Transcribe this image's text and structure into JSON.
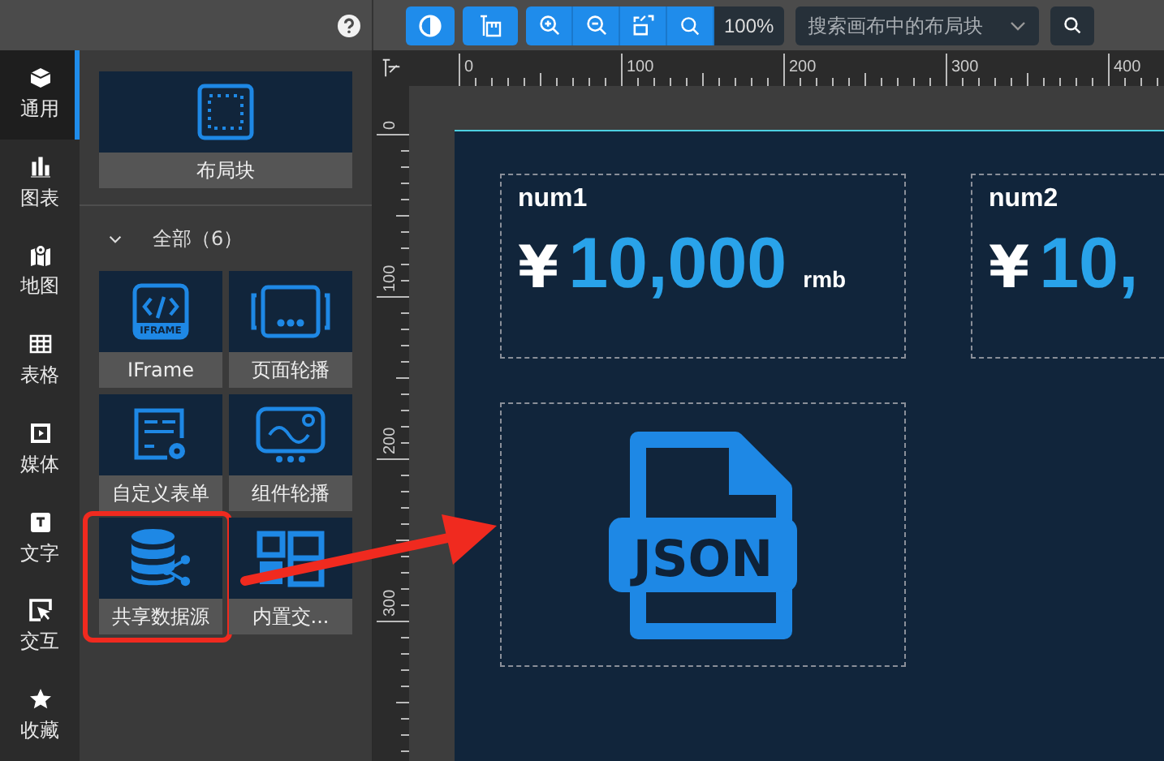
{
  "nav_items": [
    {
      "label": "通用",
      "kind": "general",
      "selected": true
    },
    {
      "label": "图表",
      "kind": "chart",
      "selected": false
    },
    {
      "label": "地图",
      "kind": "map",
      "selected": false
    },
    {
      "label": "表格",
      "kind": "table",
      "selected": false
    },
    {
      "label": "媒体",
      "kind": "media",
      "selected": false
    },
    {
      "label": "文字",
      "kind": "text",
      "selected": false
    },
    {
      "label": "交互",
      "kind": "interaction",
      "selected": false
    },
    {
      "label": "收藏",
      "kind": "favorites",
      "selected": false
    }
  ],
  "panel": {
    "featured_tile": {
      "label": "布局块"
    },
    "group": {
      "title": "全部（6）",
      "expanded": true
    },
    "tiles": [
      {
        "kind": "iframe",
        "label": "IFrame",
        "icon_text": "IFRAME",
        "highlighted": false
      },
      {
        "kind": "carousel",
        "label": "页面轮播",
        "highlighted": false
      },
      {
        "kind": "form",
        "label": "自定义表单",
        "highlighted": false
      },
      {
        "kind": "widget-carousel",
        "label": "组件轮播",
        "highlighted": false
      },
      {
        "kind": "datasource",
        "label": "共享数据源",
        "highlighted": true
      },
      {
        "kind": "builtin",
        "label": "内置交...",
        "highlighted": false
      }
    ]
  },
  "toolbar": {
    "zoom": "100%",
    "search": {
      "placeholder": "搜索画布中的布局块"
    }
  },
  "rulers": {
    "top_labels": [
      "0",
      "100",
      "200",
      "300",
      "400"
    ],
    "left_labels": [
      "0",
      "100",
      "200",
      "300"
    ]
  },
  "canvas": {
    "metric_cards": [
      {
        "title": "num1",
        "currency": "¥",
        "value": "10,000",
        "unit": "rmb"
      },
      {
        "title": "num2",
        "currency": "¥",
        "value": "10,"
      }
    ],
    "json_card": {
      "label": "JSON"
    }
  }
}
